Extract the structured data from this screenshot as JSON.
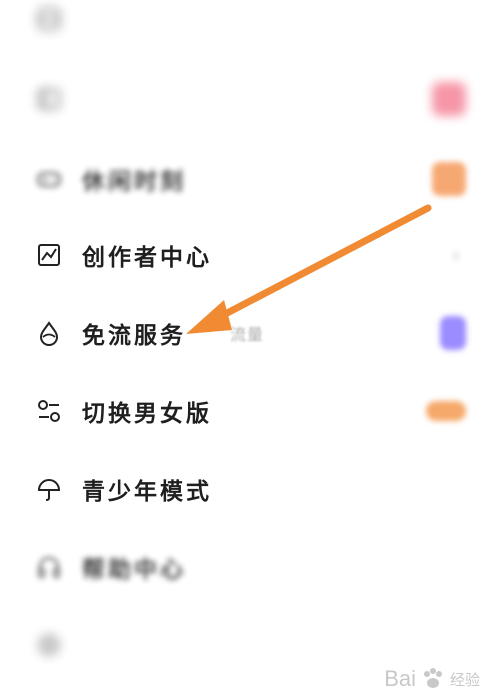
{
  "menu": {
    "items": [
      {
        "label": "",
        "sub": "",
        "icon": "grid-icon",
        "thumb": ""
      },
      {
        "label": "",
        "sub": "",
        "icon": "box-icon",
        "thumb": "#f3738a"
      },
      {
        "label": "休闲时刻",
        "sub": "",
        "icon": "gamepad-icon",
        "thumb": "#f59a5a"
      },
      {
        "label": "创作者中心",
        "sub": "",
        "icon": "chart-icon",
        "thumb": ""
      },
      {
        "label": "免流服务",
        "sub": "流量",
        "icon": "drop-icon",
        "thumb": "#9b8cff"
      },
      {
        "label": "切换男女版",
        "sub": "",
        "icon": "switch-icon",
        "thumb": "#f5a96a"
      },
      {
        "label": "青少年模式",
        "sub": "",
        "icon": "umbrella-icon",
        "thumb": ""
      },
      {
        "label": "帮助中心",
        "sub": "",
        "icon": "headphones-icon",
        "thumb": ""
      },
      {
        "label": "",
        "sub": "",
        "icon": "gear-icon",
        "thumb": ""
      }
    ]
  },
  "annotation": {
    "arrow_color": "#f08a33"
  },
  "watermark": {
    "text": "Bai",
    "suffix": "经验"
  }
}
